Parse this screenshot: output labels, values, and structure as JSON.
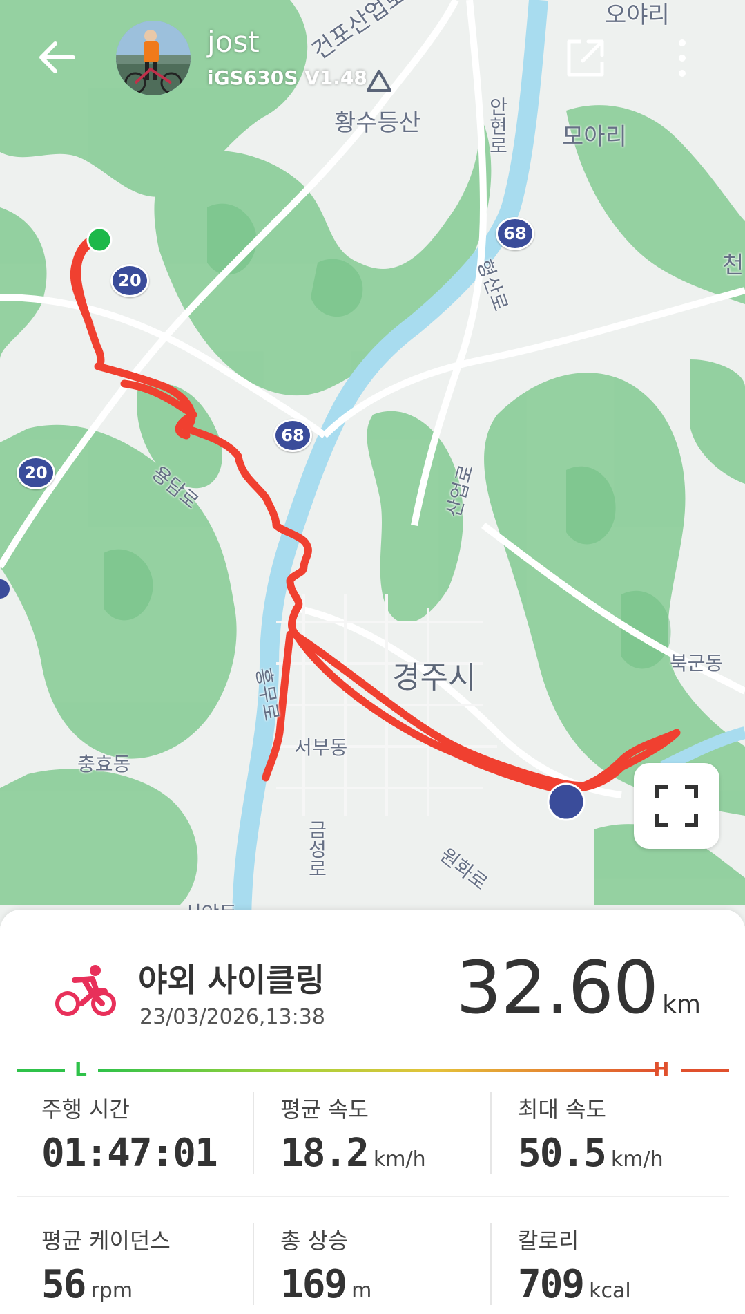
{
  "header": {
    "username": "jost",
    "device": "iGS630S  V1.48"
  },
  "map": {
    "labels": {
      "geonpo": "건포산업로",
      "oyari": "오야리",
      "hwangsu": "황수등산",
      "anhyeon": "안현로",
      "moari": "모아리",
      "cheon": "천",
      "hyeongsan": "형산로",
      "yongdam": "용담로",
      "saneop": "산업로",
      "gyeongju": "경주시",
      "bukgun": "북군동",
      "heungmu": "흥무로",
      "seobu": "서부동",
      "chunghyo": "충효동",
      "geumseong": "금성로",
      "wonhwa": "원화로",
      "seoak": "서악동"
    },
    "route_shields": {
      "r20a": "20",
      "r20b": "20",
      "r68a": "68",
      "r68b": "68"
    },
    "route_color": "#f04030",
    "start_color": "#1db84a"
  },
  "activity": {
    "title": "야외 사이클링",
    "date": "23/03/2026,13:38",
    "distance_value": "32.60",
    "distance_unit": "km",
    "scale_low": "L",
    "scale_high": "H",
    "icon_color": "#e8305a"
  },
  "stats": [
    {
      "label": "주행 시간",
      "value": "01:47:01",
      "unit": ""
    },
    {
      "label": "평균 속도",
      "value": "18.2",
      "unit": "km/h"
    },
    {
      "label": "최대 속도",
      "value": "50.5",
      "unit": "km/h"
    },
    {
      "label": "평균 케이던스",
      "value": "56",
      "unit": "rpm"
    },
    {
      "label": "총 상승",
      "value": "169",
      "unit": "m"
    },
    {
      "label": "칼로리",
      "value": "709",
      "unit": "kcal"
    }
  ]
}
